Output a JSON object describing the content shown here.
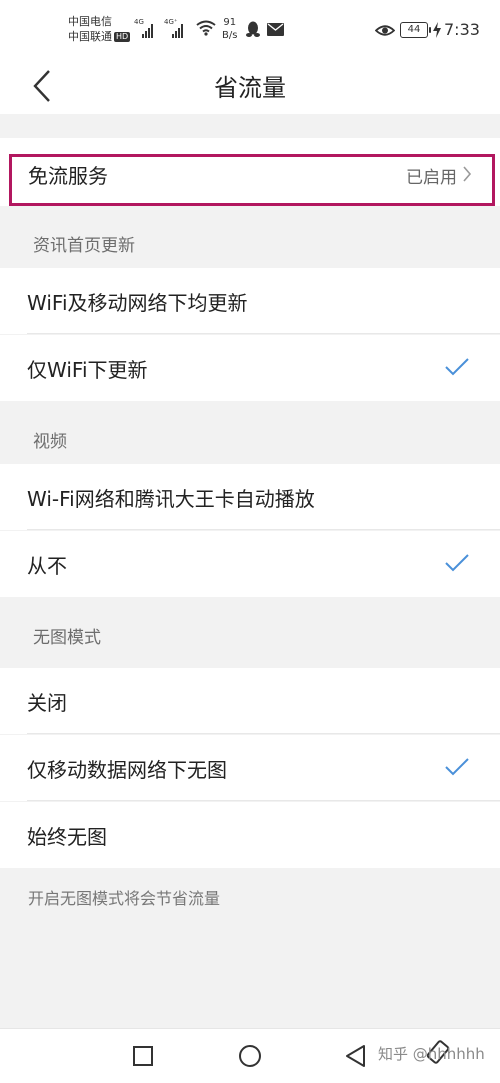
{
  "status_bar": {
    "carrier1": "中国电信",
    "carrier2": "中国联通",
    "hd_badge": "HD",
    "signal1_label": "4G",
    "signal2_label": "4G⁺",
    "net_speed_value": "91",
    "net_speed_unit": "B/s",
    "battery": "44",
    "time": "7:33"
  },
  "nav": {
    "title": "省流量"
  },
  "free_service": {
    "label": "免流服务",
    "status": "已启用",
    "highlight_color": "#b2175f"
  },
  "sections": {
    "news_update": {
      "title": "资讯首页更新",
      "options": [
        "WiFi及移动网络下均更新",
        "仅WiFi下更新"
      ],
      "selected": "仅WiFi下更新"
    },
    "video": {
      "title": "视频",
      "options": [
        "Wi-Fi网络和腾讯大王卡自动播放",
        "从不"
      ],
      "selected": "从不"
    },
    "no_image": {
      "title": "无图模式",
      "options": [
        "关闭",
        "仅移动数据网络下无图",
        "始终无图"
      ],
      "selected": "仅移动数据网络下无图"
    }
  },
  "footnote": "开启无图模式将会节省流量",
  "watermark": "知乎 @hhhhhh",
  "colors": {
    "accent_check": "#4a90d9",
    "background": "#f2f2f2"
  }
}
